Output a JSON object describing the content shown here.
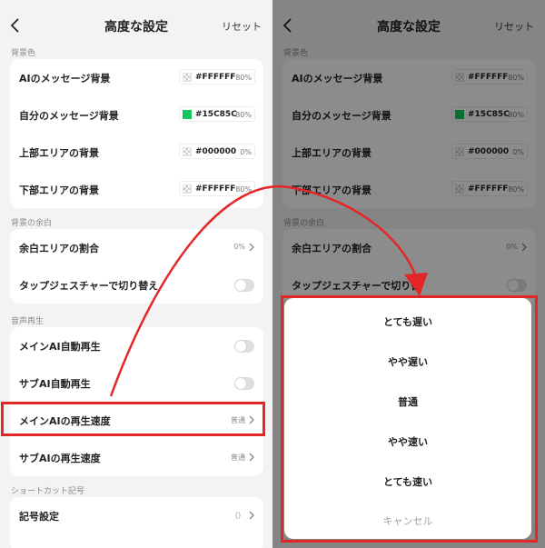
{
  "header": {
    "title": "高度な設定",
    "reset_label": "リセット"
  },
  "sections": {
    "bg_color": {
      "label": "背景色",
      "rows": [
        {
          "label": "AIのメッセージ背景",
          "hex": "#FFFFFF",
          "pct": "80%",
          "swatch": "checker"
        },
        {
          "label": "自分のメッセージ背景",
          "hex": "#15C85C",
          "pct": "80%",
          "swatch": "#15C85C"
        },
        {
          "label": "上部エリアの背景",
          "hex": "#000000",
          "pct": "0%",
          "swatch": "checker"
        },
        {
          "label": "下部エリアの背景",
          "hex": "#FFFFFF",
          "pct": "80%",
          "swatch": "checker"
        }
      ]
    },
    "bg_margin": {
      "label": "背景の余白",
      "ratio_label": "余白エリアの割合",
      "ratio_value": "0%",
      "tap_label": "タップジェスチャーで切り替え",
      "tap_label_truncated": "タップジェスチャーで切り替"
    },
    "voice": {
      "label": "音声再生",
      "main_auto_label": "メインAI自動再生",
      "sub_auto_label": "サブAI自動再生",
      "main_speed_label": "メインAIの再生速度",
      "main_speed_value": "普通",
      "sub_speed_label": "サブAIの再生速度",
      "sub_speed_value": "普通"
    },
    "shortcut": {
      "label": "ショートカット記号",
      "symbol_label": "記号設定",
      "symbol_value": "（）"
    }
  },
  "speed_sheet": {
    "options": [
      "とても遅い",
      "やや遅い",
      "普通",
      "やや速い",
      "とても速い"
    ],
    "cancel_label": "キャンセル"
  },
  "colors": {
    "accent_green": "#15C85C",
    "highlight_red": "#E42626",
    "background": "#F3F3F3"
  },
  "icons": {
    "back": "chevron-left-icon",
    "row_arrow": "chevron-right-icon",
    "callout": "curved-arrow-annotation"
  }
}
